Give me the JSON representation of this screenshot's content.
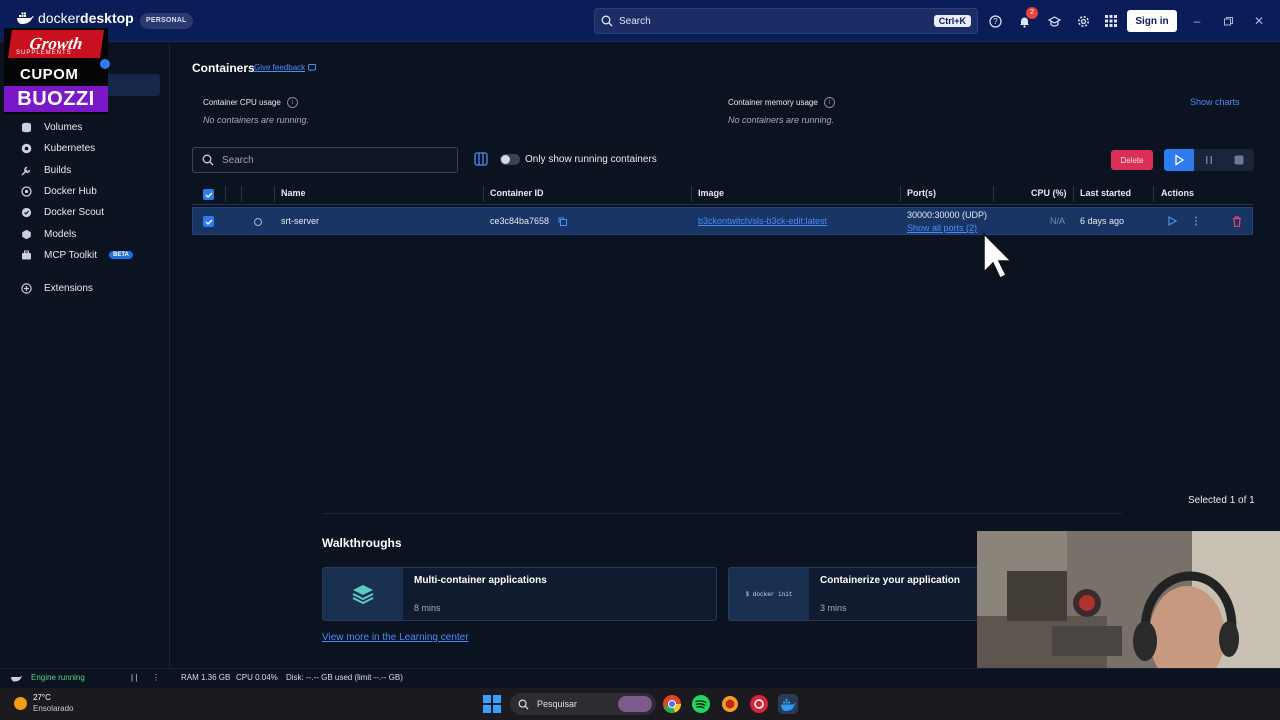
{
  "titlebar": {
    "brand_regular": "docker",
    "brand_bold": "desktop",
    "plan_badge": "PERSONAL",
    "search_placeholder": "Search",
    "search_shortcut": "Ctrl+K",
    "notifications_count": "2",
    "sign_in_label": "Sign in"
  },
  "promo": {
    "line1": "Growth",
    "line1_sub": "SUPPLEMENTS",
    "line2": "CUPOM",
    "line3": "BUOZZI"
  },
  "sidebar": {
    "items": [
      {
        "label": "Volumes",
        "icon": "volume-icon"
      },
      {
        "label": "Kubernetes",
        "icon": "kubernetes-icon"
      },
      {
        "label": "Builds",
        "icon": "wrench-icon"
      },
      {
        "label": "Docker Hub",
        "icon": "hub-icon"
      },
      {
        "label": "Docker Scout",
        "icon": "scout-icon"
      },
      {
        "label": "Models",
        "icon": "cube-icon"
      },
      {
        "label": "MCP Toolkit",
        "icon": "toolkit-icon",
        "badge": "BETA"
      },
      {
        "label": "Extensions",
        "icon": "plus-icon"
      }
    ]
  },
  "containers": {
    "title": "Containers",
    "feedback_label": "Give feedback",
    "cpu_usage_label": "Container CPU usage",
    "cpu_usage_status": "No containers are running.",
    "memory_usage_label": "Container memory usage",
    "memory_usage_status": "No containers are running.",
    "show_charts_label": "Show charts",
    "search_placeholder": "Search",
    "running_toggle_label": "Only show running containers",
    "delete_label": "Delete",
    "columns": [
      "Name",
      "Container ID",
      "Image",
      "Port(s)",
      "CPU (%)",
      "Last started",
      "Actions"
    ],
    "rows": [
      {
        "name": "srt-server",
        "container_id": "ce3c84ba7658",
        "image": "b3ckontwitch/sls-b3ck-edit:latest",
        "port": "30000:30000 (UDP)",
        "ports_link": "Show all ports (2)",
        "cpu": "N/A",
        "last_started": "6 days ago"
      }
    ],
    "selected_count": "Selected 1 of 1"
  },
  "walkthroughs": {
    "title": "Walkthroughs",
    "cards": [
      {
        "title": "Multi-container applications",
        "time": "8 mins",
        "thumb_icon": "layers-icon"
      },
      {
        "title": "Containerize your application",
        "time": "3 mins",
        "thumb_code": "$ docker init"
      }
    ],
    "learn_more": "View more in the Learning center"
  },
  "statusbar": {
    "engine": "Engine running",
    "ram": "RAM 1.36 GB",
    "cpu": "CPU 0.04%",
    "disk": "Disk: --.-- GB used (limit --.-- GB)"
  },
  "taskbar": {
    "temperature": "27°C",
    "weather": "Ensolarado",
    "search_placeholder": "Pesquisar"
  },
  "colors": {
    "accent": "#2f7bf0",
    "titlebar": "#0a1d58",
    "danger": "#dc2f55",
    "link": "#4a8df6"
  }
}
